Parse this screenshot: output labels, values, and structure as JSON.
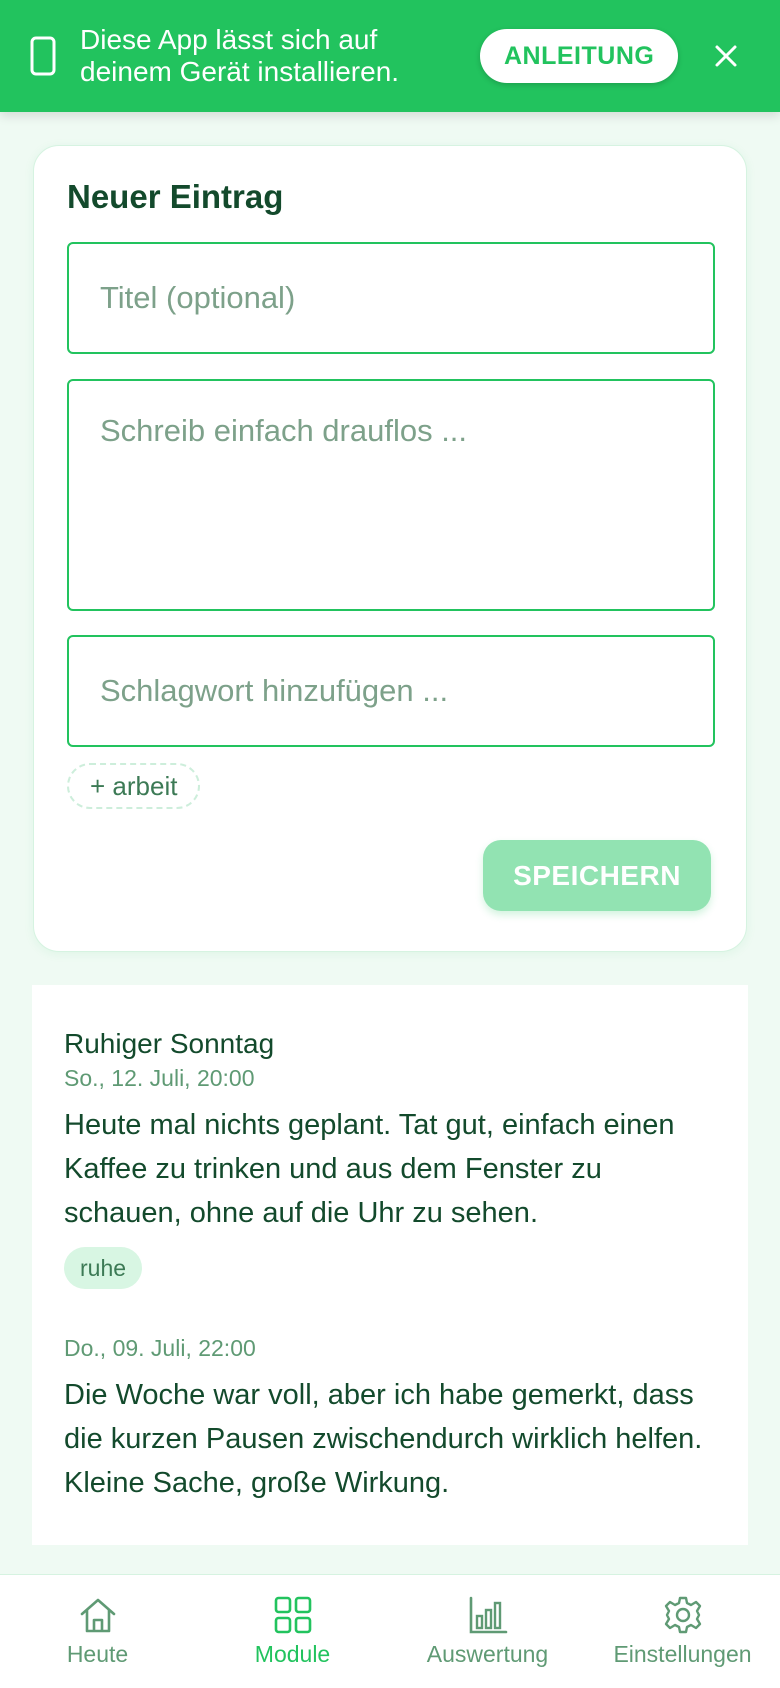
{
  "banner": {
    "line1": "Diese App lässt sich auf",
    "line2": "deinem Gerät installieren.",
    "guide_label": "ANLEITUNG",
    "icons": {
      "device": "phone-icon",
      "close": "close-icon"
    }
  },
  "new_entry": {
    "heading": "Neuer Eintrag",
    "title_placeholder": "Titel (optional)",
    "body_placeholder": "Schreib einfach drauflos ...",
    "tag_placeholder": "Schlagwort hinzufügen ...",
    "suggested_tag": "+ arbeit",
    "save_label": "SPEICHERN"
  },
  "entries": [
    {
      "title": "Ruhiger Sonntag",
      "date": "So., 12. Juli, 20:00",
      "text": "Heute mal nichts geplant. Tat gut, einfach einen Kaffee zu trinken und aus dem Fenster zu schauen, ohne auf die Uhr zu sehen.",
      "tag": "ruhe"
    },
    {
      "title": "",
      "date": "Do., 09. Juli, 22:00",
      "text": "Die Woche war voll, aber ich habe gemerkt, dass die kurzen Pausen zwischendurch wirklich helfen. Kleine Sache, große Wirkung."
    }
  ],
  "nav": {
    "items": [
      {
        "label": "Heute",
        "icon": "home-icon"
      },
      {
        "label": "Module",
        "icon": "grid-icon",
        "active": true
      },
      {
        "label": "Auswertung",
        "icon": "bar-chart-icon"
      },
      {
        "label": "Einstellungen",
        "icon": "gear-icon"
      }
    ]
  },
  "colors": {
    "accent": "#22c35e",
    "text": "#134a2c",
    "muted": "#5f9a74",
    "background": "#effaf3",
    "save_disabled": "#92e3b2"
  }
}
